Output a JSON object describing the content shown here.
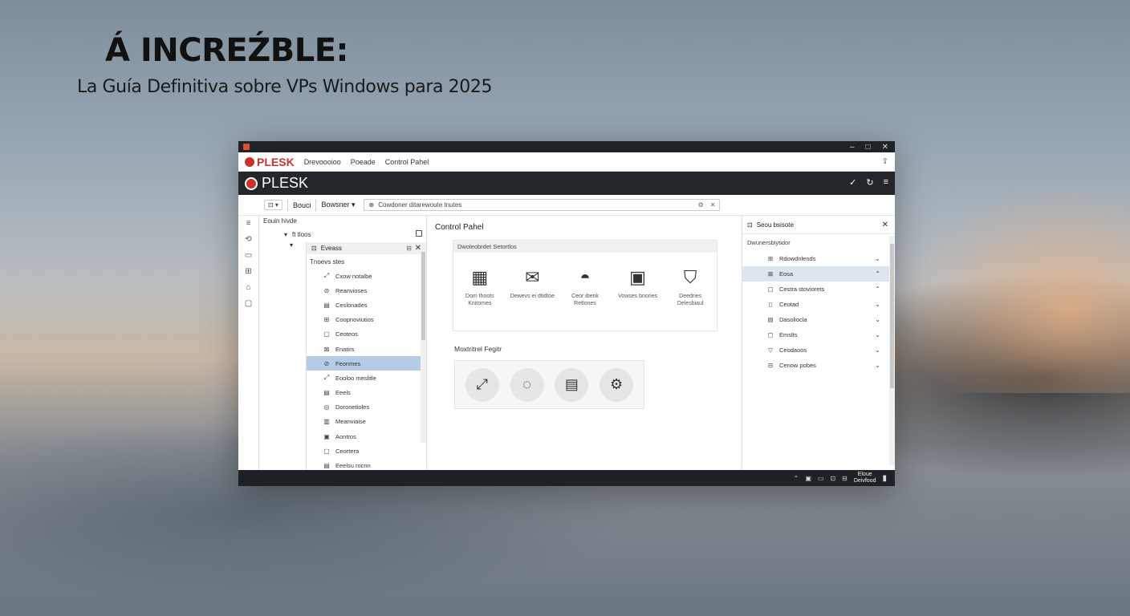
{
  "headline": "Á INCREŹBLE:",
  "subline": "La Guía Definitiva sobre VPs Windows para 2025",
  "window": {
    "controls": [
      "–",
      "□",
      "✕"
    ]
  },
  "menubar": {
    "brand": "PLESK",
    "items": [
      "Drevoooioo",
      "Poeade",
      "Control Pahel"
    ]
  },
  "brandbar": {
    "logo": "PLESK",
    "actions": [
      "✓",
      "↻",
      "≡"
    ]
  },
  "toolbar": {
    "btn1": "⊡ ▾",
    "btn2": "Bouci",
    "btn3": "Bowsner ▾",
    "address": "Cowdoner ditarewoute tnutes"
  },
  "tree": {
    "root": "Eouin hivde",
    "level1": "ft tloos",
    "panel_header": "Eveass",
    "section_title": "Tnoevs stes",
    "items": [
      {
        "icon": "⤢",
        "label": "Cxow notalbe"
      },
      {
        "icon": "⊘",
        "label": "Reanvioses"
      },
      {
        "icon": "▤",
        "label": "Ceslonades"
      },
      {
        "icon": "⊞",
        "label": "Coopnoviutios"
      },
      {
        "icon": "▢",
        "label": "Ceoteos"
      },
      {
        "icon": "⊠",
        "label": "Enatirs"
      },
      {
        "icon": "⊘",
        "label": "Feonmes",
        "selected": true
      },
      {
        "icon": "⤢",
        "label": "Eooloo meslitle"
      },
      {
        "icon": "▤",
        "label": "Eeels"
      },
      {
        "icon": "◎",
        "label": "Doronetioles"
      },
      {
        "icon": "▥",
        "label": "Meanviaise"
      },
      {
        "icon": "▣",
        "label": "Aontros"
      },
      {
        "icon": "▢",
        "label": "Ceortera"
      },
      {
        "icon": "▤",
        "label": "Eeelsu rocnn"
      }
    ]
  },
  "center": {
    "title": "Control Pahel",
    "card_header": "Dwoleobrdet Setortlos",
    "tiles": [
      {
        "icon": "▦",
        "label": "Dom thoots\nKnitomes"
      },
      {
        "icon": "✉",
        "label": "Dewevs ei dtidtoe"
      },
      {
        "icon": "◓",
        "label": "Ceor ibenk\nRetlones"
      },
      {
        "icon": "▣",
        "label": "Vowses bnories"
      },
      {
        "icon": "⛉",
        "label": "Deedries\nDelesbiaul"
      }
    ],
    "section2": "Moxtritrel Fegitr",
    "circles": [
      "⤢",
      "◌",
      "▤",
      "⚙"
    ]
  },
  "right": {
    "header": "Seou bsisote",
    "subtitle": "Dwunersbiytidor",
    "items": [
      {
        "icon": "⊞",
        "label": "Rdowdnlends",
        "chev": "⌄"
      },
      {
        "icon": "⊠",
        "label": "Eosa",
        "chev": "⌃",
        "selected": true
      },
      {
        "icon": "▢",
        "label": "Cestra stoviorets",
        "chev": "⌃"
      },
      {
        "icon": "▯",
        "label": "Ceotad",
        "chev": "⌄"
      },
      {
        "icon": "▤",
        "label": "Dasoliocla",
        "chev": "⌄"
      },
      {
        "icon": "▢",
        "label": "Emslts",
        "chev": "⌄"
      },
      {
        "icon": "▽",
        "label": "Ceodaoos",
        "chev": "⌄"
      },
      {
        "icon": "⊟",
        "label": "Cenow pobes",
        "chev": "⌄"
      }
    ]
  },
  "taskbar": {
    "tray_icons": [
      "⌃",
      "▣",
      "▭",
      "⊡",
      "⊟"
    ],
    "clock_line1": "Eloue",
    "clock_line2": "Deivfood",
    "notify": "▮"
  }
}
